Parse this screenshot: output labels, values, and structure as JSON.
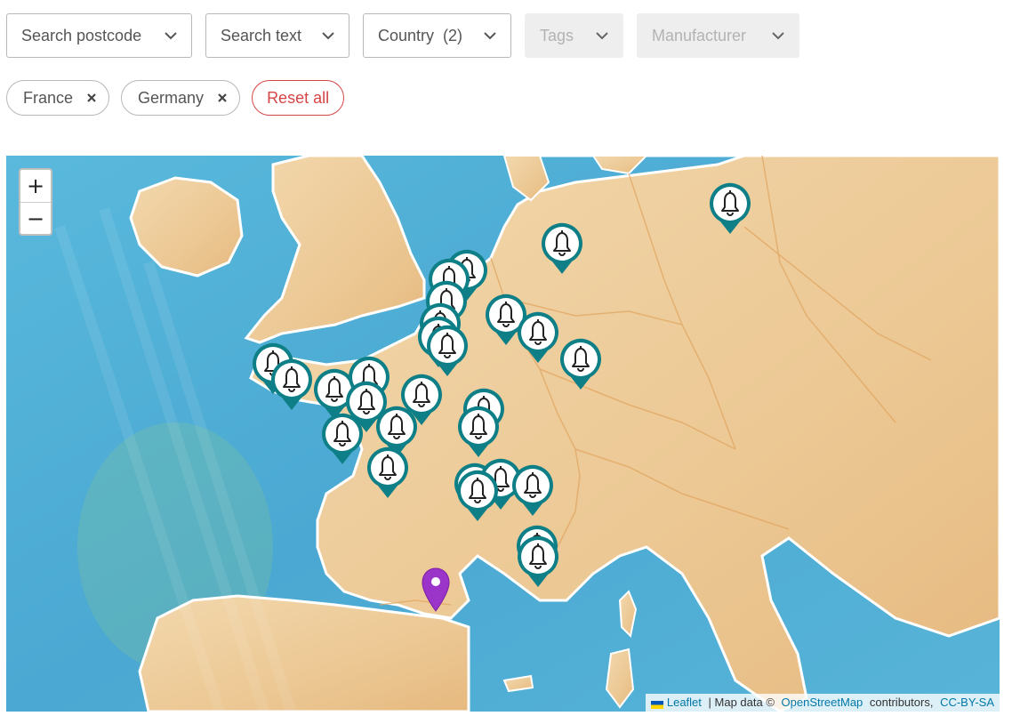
{
  "filters": {
    "search_postcode": "Search postcode",
    "search_text": "Search text",
    "country": "Country  (2)",
    "tags": "Tags",
    "manufacturer": "Manufacturer"
  },
  "chips": {
    "france": "France",
    "germany": "Germany",
    "reset": "Reset all"
  },
  "map": {
    "zoom_in": "+",
    "zoom_out": "−",
    "marker_icon": "bell-icon",
    "marker_color": "#0e7f86",
    "location_pin_color": "#9b35c9",
    "land_color": "#efcf9f",
    "sea_color": "#4fb1d8"
  },
  "attribution": {
    "leaflet": "Leaflet",
    "sep1": " | Map data © ",
    "osm": "OpenStreetMap",
    "contributors": " contributors, ",
    "license": "CC-BY-SA"
  }
}
